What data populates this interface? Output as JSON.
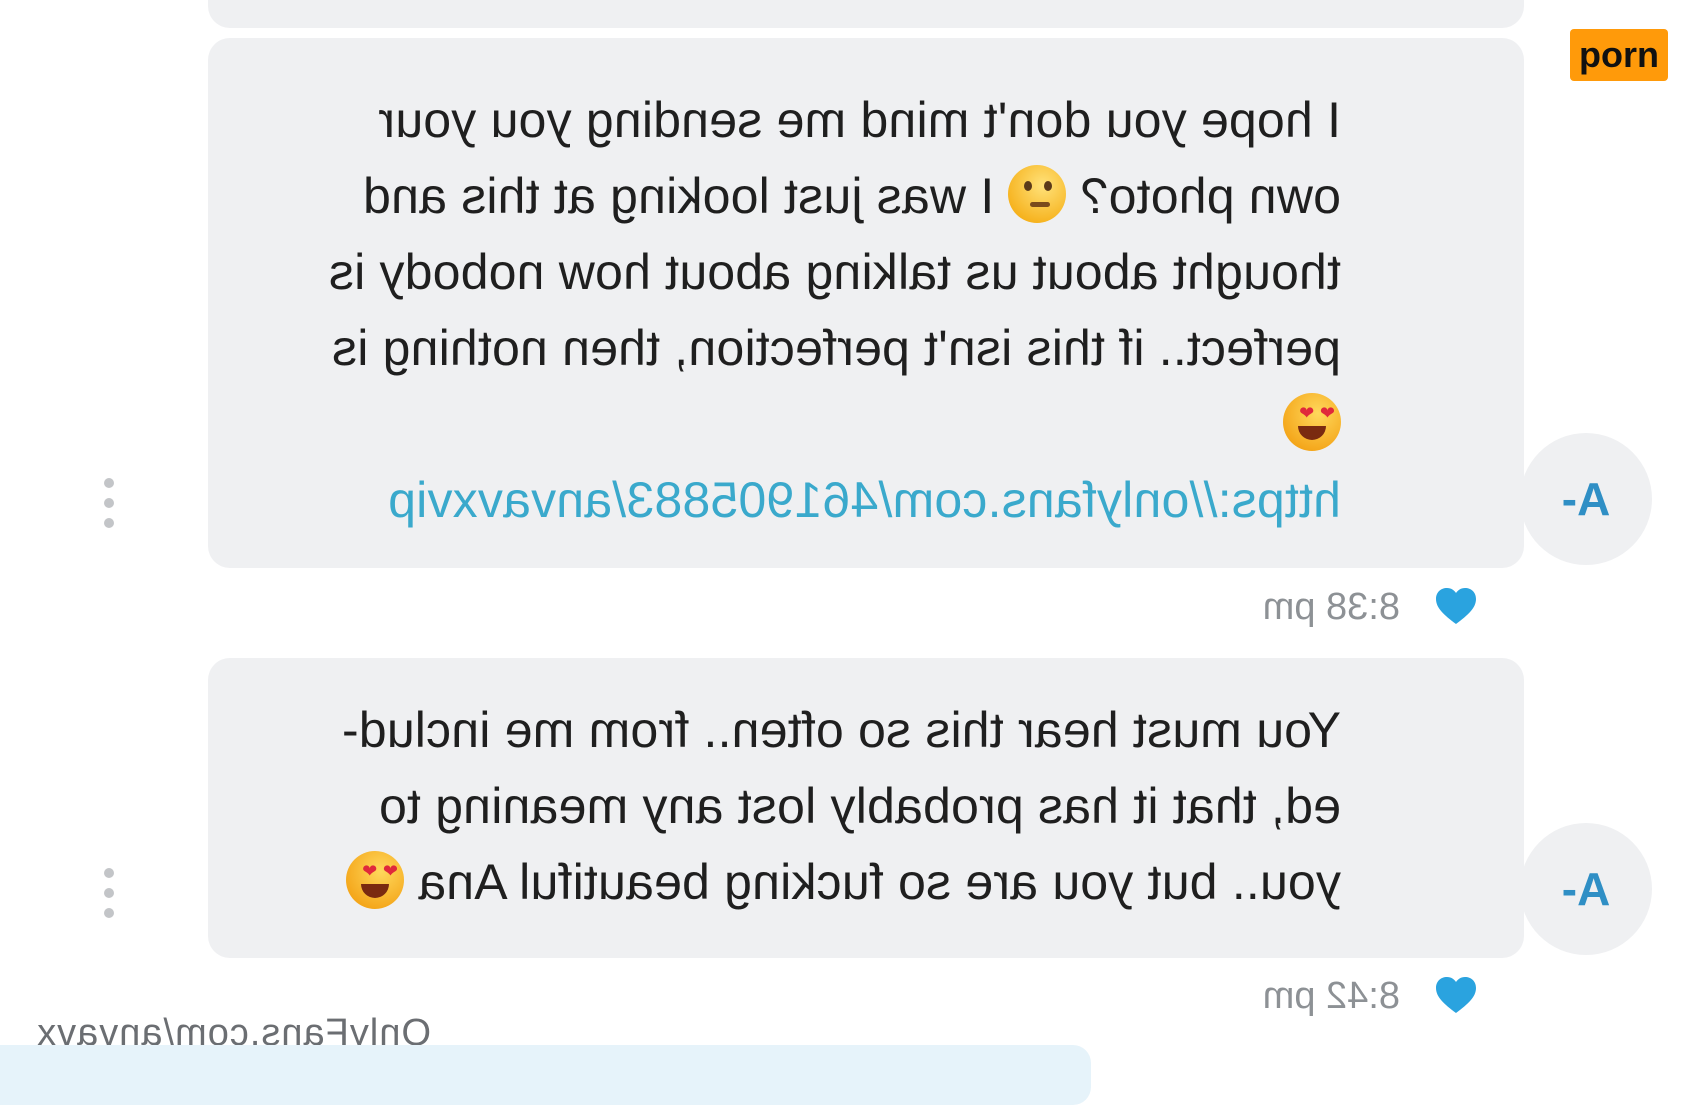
{
  "badge": {
    "label": "porn"
  },
  "messages": [
    {
      "lines": [
        "I hope you don't mind me sending you your",
        "own photo?",
        "I was just looking at this and",
        "thought about us talking about how nobody is",
        "perfect.. if this isn't perfection, then nothing is"
      ],
      "link": "https://onlyfans.com/461905883/anvavxvip",
      "time": "8:38 pm",
      "avatar_initials": "A-",
      "emojis": [
        "thinking-face-emoji",
        "heart-eyes-emoji"
      ]
    },
    {
      "lines": [
        "You must hear this so often.. from me includ-",
        "ed, that it has probably lost any meaning to",
        "you.. but you are so fucking beautiful Ana"
      ],
      "time": "8:42 pm",
      "avatar_initials": "A-",
      "emojis": [
        "heart-eyes-emoji"
      ]
    }
  ],
  "footer": {
    "watermark": "OnlyFans.com/anvavx"
  },
  "colors": {
    "bubble": "#eff0f2",
    "link": "#3aa9cc",
    "heart": "#2aa3df",
    "avatar_text": "#2f8fc5",
    "badge": "#ff9a0a"
  }
}
